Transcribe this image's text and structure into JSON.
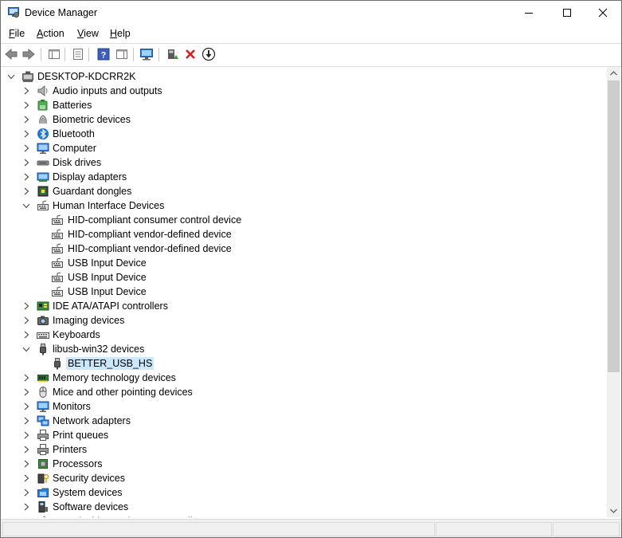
{
  "window": {
    "title": "Device Manager"
  },
  "menu": [
    {
      "label": "File",
      "key": "F",
      "rest": "ile"
    },
    {
      "label": "Action",
      "key": "A",
      "rest": "ction"
    },
    {
      "label": "View",
      "key": "V",
      "rest": "iew"
    },
    {
      "label": "Help",
      "key": "H",
      "rest": "elp"
    }
  ],
  "toolbar": [
    "back-icon",
    "forward-icon",
    "show-hide-tree-icon",
    "properties-icon",
    "help-icon",
    "update-driver-view-icon",
    "scan-hardware-icon",
    "enable-device-icon",
    "uninstall-icon",
    "download-driver-icon"
  ],
  "tree": [
    {
      "label": "DESKTOP-KDCRR2K",
      "level": 0,
      "expanded": true,
      "icon": "computer-root-icon"
    },
    {
      "label": "Audio inputs and outputs",
      "level": 1,
      "expanded": false,
      "icon": "speaker-icon"
    },
    {
      "label": "Batteries",
      "level": 1,
      "expanded": false,
      "icon": "battery-icon"
    },
    {
      "label": "Biometric devices",
      "level": 1,
      "expanded": false,
      "icon": "fingerprint-icon"
    },
    {
      "label": "Bluetooth",
      "level": 1,
      "expanded": false,
      "icon": "bluetooth-icon"
    },
    {
      "label": "Computer",
      "level": 1,
      "expanded": false,
      "icon": "monitor-icon"
    },
    {
      "label": "Disk drives",
      "level": 1,
      "expanded": false,
      "icon": "disk-drive-icon"
    },
    {
      "label": "Display adapters",
      "level": 1,
      "expanded": false,
      "icon": "display-adapter-icon"
    },
    {
      "label": "Guardant dongles",
      "level": 1,
      "expanded": false,
      "icon": "dongle-icon"
    },
    {
      "label": "Human Interface Devices",
      "level": 1,
      "expanded": true,
      "icon": "hid-icon"
    },
    {
      "label": "HID-compliant consumer control device",
      "level": 2,
      "icon": "hid-icon"
    },
    {
      "label": "HID-compliant vendor-defined device",
      "level": 2,
      "icon": "hid-icon"
    },
    {
      "label": "HID-compliant vendor-defined device",
      "level": 2,
      "icon": "hid-icon"
    },
    {
      "label": "USB Input Device",
      "level": 2,
      "icon": "hid-icon"
    },
    {
      "label": "USB Input Device",
      "level": 2,
      "icon": "hid-icon"
    },
    {
      "label": "USB Input Device",
      "level": 2,
      "icon": "hid-icon"
    },
    {
      "label": "IDE ATA/ATAPI controllers",
      "level": 1,
      "expanded": false,
      "icon": "ide-controller-icon"
    },
    {
      "label": "Imaging devices",
      "level": 1,
      "expanded": false,
      "icon": "camera-icon"
    },
    {
      "label": "Keyboards",
      "level": 1,
      "expanded": false,
      "icon": "keyboard-icon"
    },
    {
      "label": "libusb-win32 devices",
      "level": 1,
      "expanded": true,
      "icon": "usb-plug-icon"
    },
    {
      "label": "BETTER_USB_HS",
      "level": 2,
      "icon": "usb-plug-icon",
      "selected": true
    },
    {
      "label": "Memory technology devices",
      "level": 1,
      "expanded": false,
      "icon": "memory-icon"
    },
    {
      "label": "Mice and other pointing devices",
      "level": 1,
      "expanded": false,
      "icon": "mouse-icon"
    },
    {
      "label": "Monitors",
      "level": 1,
      "expanded": false,
      "icon": "monitor-icon"
    },
    {
      "label": "Network adapters",
      "level": 1,
      "expanded": false,
      "icon": "network-icon"
    },
    {
      "label": "Print queues",
      "level": 1,
      "expanded": false,
      "icon": "printer-icon"
    },
    {
      "label": "Printers",
      "level": 1,
      "expanded": false,
      "icon": "printer-icon"
    },
    {
      "label": "Processors",
      "level": 1,
      "expanded": false,
      "icon": "processor-icon"
    },
    {
      "label": "Security devices",
      "level": 1,
      "expanded": false,
      "icon": "security-key-icon"
    },
    {
      "label": "System devices",
      "level": 1,
      "expanded": false,
      "icon": "system-folder-icon"
    },
    {
      "label": "Software devices",
      "level": 1,
      "expanded": false,
      "icon": "software-device-icon"
    },
    {
      "label": "Sound, video and game controllers",
      "level": 1,
      "expanded": false,
      "icon": "speaker-icon"
    }
  ]
}
